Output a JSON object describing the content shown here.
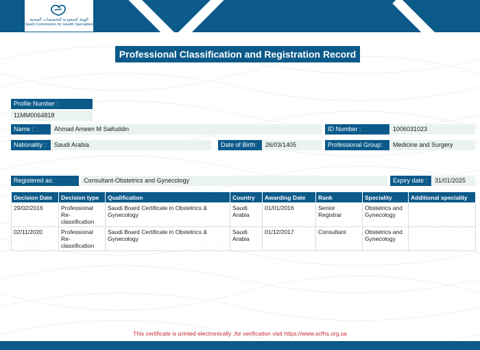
{
  "colors": {
    "primary": "#0b5a8a",
    "field_bg": "#eaf3f0",
    "note_red": "#c0282d"
  },
  "header": {
    "logo_ar": "الهيئة السعودية للتخصصات الصحية",
    "logo_en": "Saudi Commission for Health Specialties",
    "logo_icon": "scfhs-logo-icon"
  },
  "title": "Professional Classification and Registration Record",
  "profile": {
    "number_label": "Profile Number :",
    "number_value": "11MM0064818",
    "name_label": "Name :",
    "name_value": "Ahmad Ameen M Saifuddin",
    "id_label": "ID Number :",
    "id_value": "1006031023",
    "nationality_label": "Nationality :",
    "nationality_value": "Saudi Arabia",
    "dob_label": "Date of Birth:",
    "dob_value": "26/03/1405",
    "group_label": "Professional Group:",
    "group_value": "Medicine and Surgery"
  },
  "registration": {
    "registered_label": "Registered as:",
    "registered_value": "Consultant-Obstetrics and Gynecology",
    "expiry_label": "Expiry date :",
    "expiry_value": "31/01/2025"
  },
  "table": {
    "headers": [
      "Decision Date",
      "Decision type",
      "Qualification",
      "Country",
      "Awarding Date",
      "Rank",
      "Speciality",
      "Additional speciality"
    ],
    "rows": [
      [
        "29/02/2016",
        "Professional Re-classification",
        "Saudi Board Certificate in Obstetrics & Gynecology",
        "Saudi Arabia",
        "01/01/2016",
        "Senior Registrar",
        "Obstetrics and Gynecology",
        ""
      ],
      [
        "02/11/2020",
        "Professional Re-classification",
        "Saudi Board Certificate in Obstetrics & Gynecology",
        "Saudi Arabia",
        "01/12/2017",
        "Consultant",
        "Obstetrics and Gynecology",
        ""
      ]
    ]
  },
  "footer_note": "This certificate is printed electronically ,for verification visit https://www.scfhs.org.sa"
}
